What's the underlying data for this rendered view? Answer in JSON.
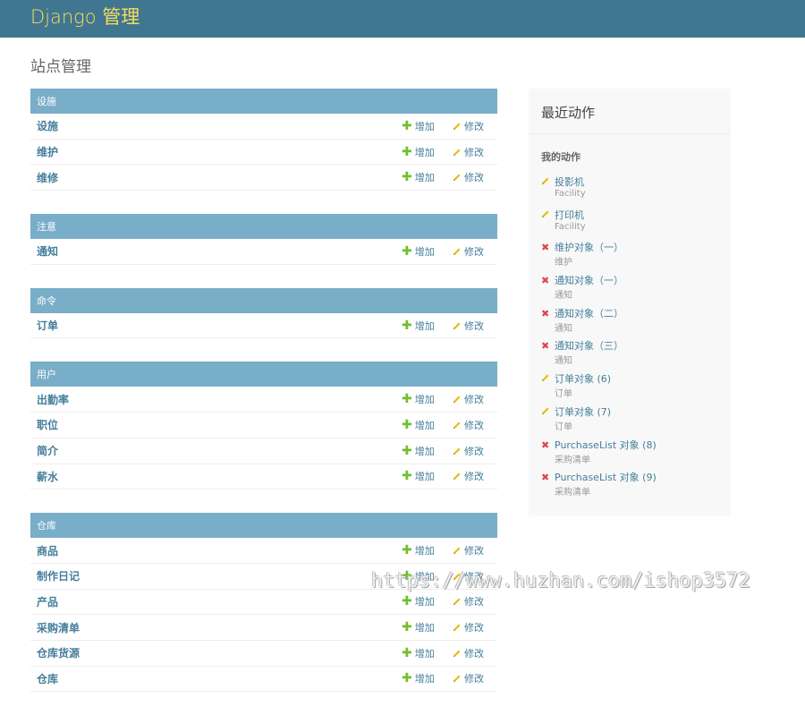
{
  "header": {
    "branding": "Django 管理"
  },
  "page": {
    "title": "站点管理"
  },
  "labels": {
    "add": "增加",
    "change": "修改"
  },
  "apps": [
    {
      "caption": "设施",
      "models": [
        "设施",
        "维护",
        "维修"
      ]
    },
    {
      "caption": "注意",
      "models": [
        "通知"
      ]
    },
    {
      "caption": "命令",
      "models": [
        "订单"
      ]
    },
    {
      "caption": "用户",
      "models": [
        "出勤率",
        "职位",
        "简介",
        "薪水"
      ]
    },
    {
      "caption": "仓库",
      "models": [
        "商品",
        "制作日记",
        "产品",
        "采购清单",
        "仓库货源",
        "仓库"
      ]
    }
  ],
  "recent": {
    "title": "最近动作",
    "subtitle": "我的动作",
    "actions": [
      {
        "icon": "pencil-icon",
        "title": "投影机",
        "type": "Facility"
      },
      {
        "icon": "pencil-icon",
        "title": "打印机",
        "type": "Facility"
      },
      {
        "icon": "delete-icon",
        "title": "维护对象（一）",
        "type": "维护"
      },
      {
        "icon": "delete-icon",
        "title": "通知对象（一）",
        "type": "通知"
      },
      {
        "icon": "delete-icon",
        "title": "通知对象（二）",
        "type": "通知"
      },
      {
        "icon": "delete-icon",
        "title": "通知对象（三）",
        "type": "通知"
      },
      {
        "icon": "pencil-icon",
        "title": "订单对象 (6)",
        "type": "订单"
      },
      {
        "icon": "pencil-icon",
        "title": "订单对象 (7)",
        "type": "订单"
      },
      {
        "icon": "delete-icon",
        "title": "PurchaseList 对象 (8)",
        "type": "采购清单"
      },
      {
        "icon": "delete-icon",
        "title": "PurchaseList 对象 (9)",
        "type": "采购清单"
      }
    ]
  },
  "watermark": "https://www.huzhan.com/ishop3572",
  "colors": {
    "header": "#417690",
    "branding": "#f5dd5d",
    "caption": "#79aec8",
    "link": "#447e9b",
    "add": "#70bf2b",
    "delete": "#dd4646",
    "pencil": "#efb80b"
  }
}
